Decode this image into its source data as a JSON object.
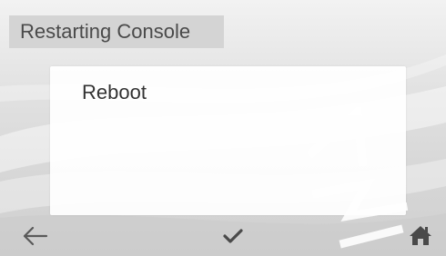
{
  "header": {
    "title": "Restarting Console"
  },
  "panel": {
    "items": [
      {
        "label": "Reboot"
      }
    ]
  },
  "nav": {
    "back_icon": "arrow-left-icon",
    "confirm_icon": "checkmark-icon",
    "home_icon": "home-icon"
  },
  "colors": {
    "background": "#e2e2e2",
    "title_bar": "#d4d4d4",
    "panel": "#ffffff",
    "text": "#333333",
    "icon": "#555555"
  }
}
